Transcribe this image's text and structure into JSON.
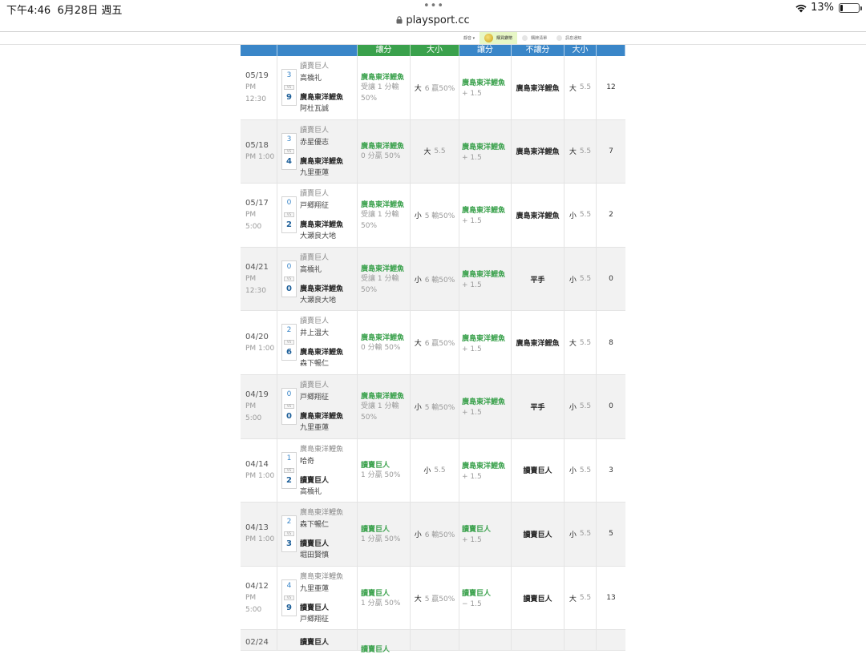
{
  "status_bar": {
    "time": "下午4:46",
    "date": "6月28日 週五",
    "battery": "13%",
    "battery_level": 0.13
  },
  "browser": {
    "dots": "•••",
    "url": "playsport.cc"
  },
  "mini_toolbar": {
    "items": [
      "靜音 ▾",
      "購買鑽幣",
      "購牌清單",
      "訊息通知"
    ],
    "active_index": 1
  },
  "table": {
    "headers": [
      {
        "label": "",
        "color": "blue"
      },
      {
        "label": "",
        "color": "blue"
      },
      {
        "label": "讓分",
        "color": "green"
      },
      {
        "label": "大小",
        "color": "green",
        "small": true
      },
      {
        "label": "讓分",
        "color": "blue"
      },
      {
        "label": "不讓分",
        "color": "blue",
        "small": true
      },
      {
        "label": "大小",
        "color": "blue",
        "small": true
      },
      {
        "label": "",
        "color": "blue"
      }
    ],
    "rows": [
      {
        "date": "05/19",
        "ampm": "PM",
        "time": "12:30",
        "away": "讀賣巨人",
        "away_pitcher": "高橋礼",
        "away_score": "3",
        "vs": "VS",
        "home_score": "9",
        "home": "廣島東洋鯉魚",
        "home_pitcher": "阿杜瓦誠",
        "spread_team": "廣島東洋鯉魚",
        "spread_line": "受讓 1 分輸 50%",
        "ou": "大",
        "ou_val": "6  贏50%",
        "spread2_team": "廣島東洋鯉魚",
        "spread2_line": "+ 1.5",
        "ml": "廣島東洋鯉魚",
        "ou2": "大",
        "ou2_val": "5.5",
        "total": "12"
      },
      {
        "date": "05/18",
        "ampm": "PM 1:00",
        "time": "",
        "away": "讀賣巨人",
        "away_pitcher": "赤星優志",
        "away_score": "3",
        "vs": "VS",
        "home_score": "4",
        "home": "廣島東洋鯉魚",
        "home_pitcher": "九里亜蓮",
        "spread_team": "廣島東洋鯉魚",
        "spread_line": "0 分贏 50%",
        "ou": "大",
        "ou_val": "5.5",
        "spread2_team": "廣島東洋鯉魚",
        "spread2_line": "+ 1.5",
        "ml": "廣島東洋鯉魚",
        "ou2": "大",
        "ou2_val": "5.5",
        "total": "7"
      },
      {
        "date": "05/17",
        "ampm": "PM",
        "time": "5:00",
        "away": "讀賣巨人",
        "away_pitcher": "戸郷翔征",
        "away_score": "0",
        "vs": "VS",
        "home_score": "2",
        "home": "廣島東洋鯉魚",
        "home_pitcher": "大瀬良大地",
        "spread_team": "廣島東洋鯉魚",
        "spread_line": "受讓 1 分輸 50%",
        "ou": "小",
        "ou_val": "5  輸50%",
        "spread2_team": "廣島東洋鯉魚",
        "spread2_line": "+ 1.5",
        "ml": "廣島東洋鯉魚",
        "ou2": "小",
        "ou2_val": "5.5",
        "total": "2"
      },
      {
        "date": "04/21",
        "ampm": "PM",
        "time": "12:30",
        "away": "讀賣巨人",
        "away_pitcher": "高橋礼",
        "away_score": "0",
        "vs": "VS",
        "home_score": "0",
        "home": "廣島東洋鯉魚",
        "home_pitcher": "大瀬良大地",
        "spread_team": "廣島東洋鯉魚",
        "spread_line": "受讓 1 分輸 50%",
        "ou": "小",
        "ou_val": "6  輸50%",
        "spread2_team": "廣島東洋鯉魚",
        "spread2_line": "+ 1.5",
        "ml": "平手",
        "ou2": "小",
        "ou2_val": "5.5",
        "total": "0"
      },
      {
        "date": "04/20",
        "ampm": "PM 1:00",
        "time": "",
        "away": "讀賣巨人",
        "away_pitcher": "井上温大",
        "away_score": "2",
        "vs": "VS",
        "home_score": "6",
        "home": "廣島東洋鯉魚",
        "home_pitcher": "森下暢仁",
        "spread_team": "廣島東洋鯉魚",
        "spread_line": "0 分輸 50%",
        "ou": "大",
        "ou_val": "6  贏50%",
        "spread2_team": "廣島東洋鯉魚",
        "spread2_line": "+ 1.5",
        "ml": "廣島東洋鯉魚",
        "ou2": "大",
        "ou2_val": "5.5",
        "total": "8"
      },
      {
        "date": "04/19",
        "ampm": "PM",
        "time": "5:00",
        "away": "讀賣巨人",
        "away_pitcher": "戸郷翔征",
        "away_score": "0",
        "vs": "VS",
        "home_score": "0",
        "home": "廣島東洋鯉魚",
        "home_pitcher": "九里亜蓮",
        "spread_team": "廣島東洋鯉魚",
        "spread_line": "受讓 1 分輸 50%",
        "ou": "小",
        "ou_val": "5  輸50%",
        "spread2_team": "廣島東洋鯉魚",
        "spread2_line": "+ 1.5",
        "ml": "平手",
        "ou2": "小",
        "ou2_val": "5.5",
        "total": "0"
      },
      {
        "date": "04/14",
        "ampm": "PM 1:00",
        "time": "",
        "away": "廣島東洋鯉魚",
        "away_pitcher": "哈奇",
        "away_score": "1",
        "vs": "VS",
        "home_score": "2",
        "home": "讀賣巨人",
        "home_pitcher": "高橋礼",
        "spread_team": "讀賣巨人",
        "spread_line": "1 分贏 50%",
        "ou": "小",
        "ou_val": "5.5",
        "spread2_team": "廣島東洋鯉魚",
        "spread2_line": "+ 1.5",
        "ml": "讀賣巨人",
        "ou2": "小",
        "ou2_val": "5.5",
        "total": "3"
      },
      {
        "date": "04/13",
        "ampm": "PM 1:00",
        "time": "",
        "away": "廣島東洋鯉魚",
        "away_pitcher": "森下暢仁",
        "away_score": "2",
        "vs": "VS",
        "home_score": "3",
        "home": "讀賣巨人",
        "home_pitcher": "堀田賢慎",
        "spread_team": "讀賣巨人",
        "spread_line": "1 分贏 50%",
        "ou": "小",
        "ou_val": "6  輸50%",
        "spread2_team": "讀賣巨人",
        "spread2_line": "+ 1.5",
        "ml": "讀賣巨人",
        "ou2": "小",
        "ou2_val": "5.5",
        "total": "5"
      },
      {
        "date": "04/12",
        "ampm": "PM",
        "time": "5:00",
        "away": "廣島東洋鯉魚",
        "away_pitcher": "九里亜蓮",
        "away_score": "4",
        "vs": "VS",
        "home_score": "9",
        "home": "讀賣巨人",
        "home_pitcher": "戸郷翔征",
        "spread_team": "讀賣巨人",
        "spread_line": "1 分贏 50%",
        "ou": "大",
        "ou_val": "5  贏50%",
        "spread2_team": "讀賣巨人",
        "spread2_line": "− 1.5",
        "ml": "讀賣巨人",
        "ou2": "大",
        "ou2_val": "5.5",
        "total": "13"
      }
    ],
    "partial_row": {
      "date": "02/24",
      "home": "讀賣巨人",
      "spread_team": "讀賣巨人"
    }
  }
}
